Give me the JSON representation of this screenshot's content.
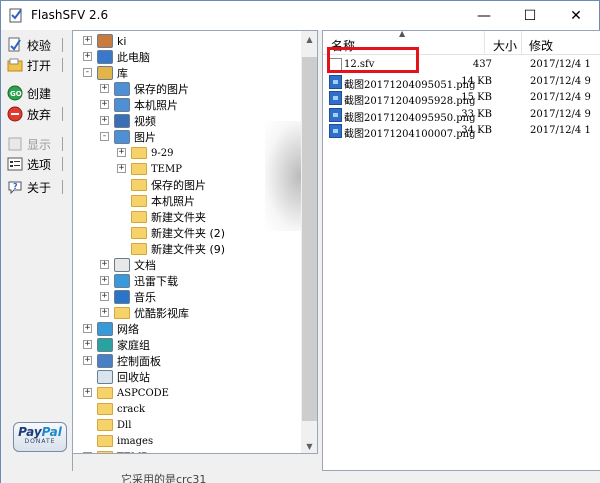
{
  "window": {
    "title": "FlashSFV 2.6"
  },
  "controls": {
    "minimize": "—",
    "maximize": "☐",
    "close": "✕"
  },
  "toolbar": [
    {
      "label": "校验",
      "icon": "verify-icon",
      "enabled": true
    },
    {
      "label": "打开",
      "icon": "open-icon",
      "enabled": true
    },
    {
      "label": "创建",
      "icon": "create-icon",
      "enabled": true
    },
    {
      "label": "放弃",
      "icon": "abort-icon",
      "enabled": true
    },
    {
      "label": "显示",
      "icon": "show-icon",
      "enabled": false
    },
    {
      "label": "选项",
      "icon": "options-icon",
      "enabled": true
    },
    {
      "label": "关于",
      "icon": "about-icon",
      "enabled": true
    }
  ],
  "paypal": {
    "brand_a": "Pay",
    "brand_b": "Pal",
    "sub": "DONATE"
  },
  "tree": [
    {
      "label": "ki",
      "level": 0,
      "exp": "+",
      "icon": "user-icon"
    },
    {
      "label": "此电脑",
      "level": 0,
      "exp": "+",
      "icon": "computer-icon"
    },
    {
      "label": "库",
      "level": 0,
      "exp": "-",
      "icon": "library-icon"
    },
    {
      "label": "保存的图片",
      "level": 1,
      "exp": "+",
      "icon": "pictures-library-icon"
    },
    {
      "label": "本机照片",
      "level": 1,
      "exp": "+",
      "icon": "pictures-library-icon"
    },
    {
      "label": "视频",
      "level": 1,
      "exp": "+",
      "icon": "video-library-icon"
    },
    {
      "label": "图片",
      "level": 1,
      "exp": "-",
      "icon": "pictures-library-icon"
    },
    {
      "label": "9-29",
      "level": 2,
      "exp": "+",
      "icon": "folder-icon",
      "mono": true
    },
    {
      "label": "TEMP",
      "level": 2,
      "exp": "+",
      "icon": "folder-icon",
      "mono": true
    },
    {
      "label": "保存的图片",
      "level": 2,
      "exp": "",
      "icon": "folder-icon"
    },
    {
      "label": "本机照片",
      "level": 2,
      "exp": "",
      "icon": "folder-icon"
    },
    {
      "label": "新建文件夹",
      "level": 2,
      "exp": "",
      "icon": "folder-icon"
    },
    {
      "label": "新建文件夹 (2)",
      "level": 2,
      "exp": "",
      "icon": "folder-icon"
    },
    {
      "label": "新建文件夹 (9)",
      "level": 2,
      "exp": "",
      "icon": "folder-icon"
    },
    {
      "label": "文档",
      "level": 1,
      "exp": "+",
      "icon": "documents-library-icon"
    },
    {
      "label": "迅雷下载",
      "level": 1,
      "exp": "+",
      "icon": "download-library-icon"
    },
    {
      "label": "音乐",
      "level": 1,
      "exp": "+",
      "icon": "music-library-icon"
    },
    {
      "label": "优酷影视库",
      "level": 1,
      "exp": "+",
      "icon": "folder-icon"
    },
    {
      "label": "网络",
      "level": 0,
      "exp": "+",
      "icon": "network-icon"
    },
    {
      "label": "家庭组",
      "level": 0,
      "exp": "+",
      "icon": "homegroup-icon"
    },
    {
      "label": "控制面板",
      "level": 0,
      "exp": "+",
      "icon": "control-panel-icon"
    },
    {
      "label": "回收站",
      "level": 0,
      "exp": "",
      "icon": "recycle-bin-icon"
    },
    {
      "label": "ASPCODE",
      "level": 0,
      "exp": "+",
      "icon": "folder-icon",
      "mono": true
    },
    {
      "label": "crack",
      "level": 0,
      "exp": "",
      "icon": "folder-icon",
      "mono": true
    },
    {
      "label": "Dll",
      "level": 0,
      "exp": "",
      "icon": "folder-icon",
      "mono": true
    },
    {
      "label": "images",
      "level": 0,
      "exp": "",
      "icon": "folder-icon",
      "mono": true
    },
    {
      "label": "TEMP",
      "level": 0,
      "exp": "+",
      "icon": "folder-icon",
      "mono": true
    }
  ],
  "list": {
    "columns": {
      "name": "名称",
      "size": "大小",
      "modified": "修改"
    },
    "rows": [
      {
        "name": "12.sfv",
        "size": "437",
        "modified": "2017/12/4 1",
        "icon": "sfv-file-icon"
      },
      {
        "name": "截图20171204095051.png",
        "size": "14 KB",
        "modified": "2017/12/4 9",
        "icon": "png-file-icon"
      },
      {
        "name": "截图20171204095928.png",
        "size": "15 KB",
        "modified": "2017/12/4 9",
        "icon": "png-file-icon"
      },
      {
        "name": "截图20171204095950.png",
        "size": "33 KB",
        "modified": "2017/12/4 9",
        "icon": "png-file-icon"
      },
      {
        "name": "截图20171204100007.png",
        "size": "34 KB",
        "modified": "2017/12/4 1",
        "icon": "png-file-icon"
      }
    ]
  },
  "footer_text": "它采用的是crc31",
  "colors": {
    "highlight": "#e4121b",
    "folder": "#f6d36a",
    "accent": "#2f6fc8"
  }
}
